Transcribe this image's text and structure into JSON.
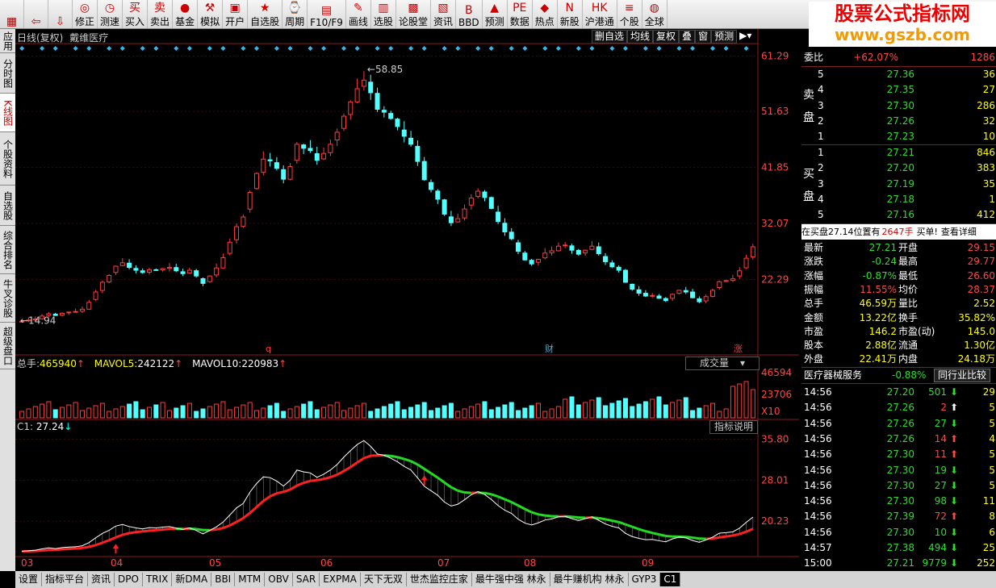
{
  "toolbar": {
    "items": [
      {
        "label": "",
        "icon": "grid-icon"
      },
      {
        "label": "",
        "icon": "back-arrow-icon"
      },
      {
        "label": "",
        "icon": "forward-arrow-icon"
      },
      {
        "label": "修正",
        "icon": "refresh-icon"
      },
      {
        "label": "测速",
        "icon": "clock-icon"
      },
      {
        "label": "买入",
        "icon": "buy-icon"
      },
      {
        "label": "卖出",
        "icon": "sell-icon"
      },
      {
        "label": "基金",
        "icon": "fund-icon"
      },
      {
        "label": "模拟",
        "icon": "hammer-icon"
      },
      {
        "label": "开户",
        "icon": "open-account-icon"
      },
      {
        "label": "自选股",
        "icon": "star-icon"
      },
      {
        "label": "周期",
        "icon": "cycle-icon"
      },
      {
        "label": "F10/F9",
        "icon": "info-icon"
      },
      {
        "label": "画线",
        "icon": "draw-icon"
      },
      {
        "label": "选股",
        "icon": "filter-icon"
      },
      {
        "label": "论股堂",
        "icon": "forum-icon"
      },
      {
        "label": "资讯",
        "icon": "news-icon"
      },
      {
        "label": "BBD",
        "icon": "bbd-icon"
      },
      {
        "label": "预测",
        "icon": "forecast-icon"
      },
      {
        "label": "数据",
        "icon": "pe-icon"
      },
      {
        "label": "热点",
        "icon": "hot-icon"
      },
      {
        "label": "新股",
        "icon": "new-icon"
      },
      {
        "label": "沪港通",
        "icon": "hk-icon"
      },
      {
        "label": "个股",
        "icon": "market-icon"
      },
      {
        "label": "全球",
        "icon": "global-icon"
      }
    ]
  },
  "logo": {
    "line1": "股票公式指标网",
    "line2": "www.gszb.com"
  },
  "left_tabs": [
    "应用",
    "分时图",
    "K线图",
    "个股资料",
    "自选股",
    "综合排名",
    "牛叉诊股",
    "超级盘口"
  ],
  "chart_header": {
    "title": "日线(复权)",
    "stock": "戴维医疗",
    "buttons": [
      "删自选",
      "均线",
      "复权",
      "叠",
      "窗",
      "预测"
    ]
  },
  "volume_header": {
    "name": "总手:",
    "value": "465940",
    "ma5_label": "MAVOL5:",
    "ma5": "242122",
    "ma10_label": "MAVOL10:",
    "ma10": "220983",
    "dropdown": "成交量"
  },
  "indicator_header": {
    "name": "C1:",
    "value": "27.24",
    "button": "指标说明"
  },
  "markers": {
    "high": "58.85",
    "low": "14.94",
    "q": "q",
    "cai": "财",
    "zhang": "涨"
  },
  "chart_data": [
    {
      "type": "candlestick",
      "title": "日线(复权) 戴维医疗",
      "y_ticks": [
        "61.29",
        "51.63",
        "41.85",
        "32.07",
        "22.29"
      ],
      "y_range": [
        12.5,
        63.2
      ],
      "close": [
        15.0,
        15.2,
        15.4,
        15.9,
        16.3,
        16.0,
        16.4,
        16.6,
        16.7,
        17.1,
        18.3,
        20.1,
        21.8,
        23.0,
        24.6,
        25.2,
        24.4,
        23.9,
        23.5,
        24.0,
        23.9,
        24.2,
        24.4,
        23.8,
        23.3,
        23.9,
        22.9,
        21.6,
        22.9,
        24.3,
        26.1,
        28.8,
        31.5,
        33.2,
        37.5,
        40.8,
        43.3,
        43.0,
        41.7,
        39.8,
        42.0,
        45.9,
        45.2,
        44.8,
        43.1,
        44.3,
        45.9,
        48.0,
        50.8,
        53.3,
        55.6,
        57.1,
        54.9,
        52.0,
        51.5,
        50.4,
        49.0,
        47.3,
        45.9,
        42.9,
        39.7,
        38.0,
        36.3,
        33.7,
        32.2,
        32.9,
        34.6,
        36.5,
        37.7,
        36.6,
        34.7,
        32.4,
        30.6,
        29.4,
        27.2,
        25.7,
        25.0,
        25.8,
        26.9,
        27.3,
        28.1,
        28.3,
        27.4,
        26.7,
        27.4,
        28.1,
        26.8,
        25.4,
        24.5,
        23.9,
        21.8,
        20.6,
        19.9,
        19.4,
        19.5,
        19.0,
        18.6,
        19.7,
        20.4,
        20.1,
        19.1,
        18.4,
        19.3,
        20.4,
        21.9,
        22.1,
        22.4,
        23.8,
        26.0,
        28.0
      ],
      "markers_high": 58.85,
      "markers_low": 14.94
    },
    {
      "type": "bar",
      "title": "成交量",
      "y_ticks": [
        "46594",
        "23706",
        "X10"
      ]
    },
    {
      "type": "line",
      "title": "C1",
      "y_ticks": [
        "35.80",
        "28.01",
        "20.23"
      ],
      "x_ticks": [
        "03",
        "04",
        "05",
        "06",
        "07",
        "08",
        "09"
      ],
      "y_range": [
        13.5,
        36.5
      ]
    }
  ],
  "quote": {
    "weibi_label": "委比",
    "weibi": "+62.07%",
    "weicha": "1286",
    "sell_label1": "卖",
    "sell_label2": "盘",
    "buy_label1": "买",
    "buy_label2": "盘",
    "sell": [
      {
        "n": "5",
        "p": "27.36",
        "v": "36"
      },
      {
        "n": "4",
        "p": "27.35",
        "v": "27"
      },
      {
        "n": "3",
        "p": "27.30",
        "v": "286"
      },
      {
        "n": "2",
        "p": "27.26",
        "v": "32"
      },
      {
        "n": "1",
        "p": "27.23",
        "v": "10"
      }
    ],
    "buy": [
      {
        "n": "1",
        "p": "27.21",
        "v": "846"
      },
      {
        "n": "2",
        "p": "27.20",
        "v": "383"
      },
      {
        "n": "3",
        "p": "27.19",
        "v": "35"
      },
      {
        "n": "4",
        "p": "27.18",
        "v": "1"
      },
      {
        "n": "5",
        "p": "27.16",
        "v": "412"
      }
    ],
    "notice": "在买盘27.14位置有",
    "notice_vol": "2647手",
    "notice_tail": "买单!",
    "notice_link": "查看详细",
    "stats": [
      {
        "l": "最新",
        "v": "27.21",
        "r": "开盘",
        "rv": "29.15"
      },
      {
        "l": "涨跌",
        "v": "-0.24",
        "r": "最高",
        "rv": "29.77"
      },
      {
        "l": "涨幅",
        "v": "-0.87%",
        "r": "最低",
        "rv": "26.60"
      },
      {
        "l": "振幅",
        "v": "11.55%",
        "r": "均价",
        "rv": "28.37"
      },
      {
        "l": "总手",
        "v": "46.59万",
        "r": "量比",
        "rv": "2.52"
      },
      {
        "l": "金额",
        "v": "13.22亿",
        "r": "换手",
        "rv": "35.82%"
      },
      {
        "l": "市盈",
        "v": "146.2",
        "r": "市盈(动)",
        "rv": "145.0"
      },
      {
        "l": "股本",
        "v": "2.88亿",
        "r": "流通",
        "rv": "1.30亿"
      },
      {
        "l": "外盘",
        "v": "22.41万",
        "r": "内盘",
        "rv": "24.18万"
      }
    ],
    "sector": "医疗器械服务",
    "sector_chg": "-0.88%",
    "sector_btn": "同行业比较",
    "ticks": [
      {
        "t": "14:56",
        "p": "27.20",
        "v": "501",
        "d": "down",
        "x": "29"
      },
      {
        "t": "14:56",
        "p": "27.26",
        "v": "2",
        "d": "up",
        "x": "5"
      },
      {
        "t": "14:56",
        "p": "27.26",
        "v": "27",
        "d": "down",
        "x": "5"
      },
      {
        "t": "14:56",
        "p": "27.26",
        "v": "14",
        "d": "up",
        "x": "4"
      },
      {
        "t": "14:56",
        "p": "27.30",
        "v": "11",
        "d": "up",
        "x": "5"
      },
      {
        "t": "14:56",
        "p": "27.30",
        "v": "19",
        "d": "down",
        "x": "5"
      },
      {
        "t": "14:56",
        "p": "27.30",
        "v": "27",
        "d": "down",
        "x": "5"
      },
      {
        "t": "14:56",
        "p": "27.30",
        "v": "98",
        "d": "down",
        "x": "11"
      },
      {
        "t": "14:56",
        "p": "27.39",
        "v": "72",
        "d": "up",
        "x": "8"
      },
      {
        "t": "14:56",
        "p": "27.30",
        "v": "10",
        "d": "down",
        "x": "6"
      },
      {
        "t": "14:57",
        "p": "27.38",
        "v": "494",
        "d": "down",
        "x": "25"
      },
      {
        "t": "15:00",
        "p": "27.21",
        "v": "9779",
        "d": "down",
        "x": "252"
      }
    ]
  },
  "bottom_tabs": [
    "设置",
    "指标平台",
    "资讯",
    "DPO",
    "TRIX",
    "新DMA",
    "BBI",
    "MTM",
    "OBV",
    "SAR",
    "EXPMA",
    "天下无双",
    "世杰监控庄家",
    "最牛强中强 林永",
    "最牛赚机构 林永",
    "GYP3",
    "C1"
  ]
}
